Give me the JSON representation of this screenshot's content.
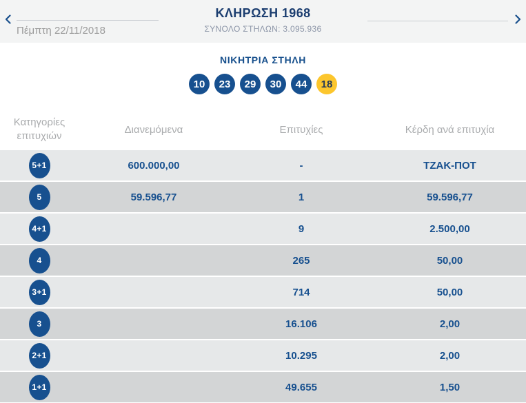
{
  "header": {
    "title": "ΚΛΗΡΩΣΗ 1968",
    "total_columns": "ΣΥΝΟΛΟ ΣΤΗΛΩΝ: 3.095.936",
    "date": "Πέμπτη 22/11/2018"
  },
  "winning": {
    "label": "ΝΙΚΗΤΡΙΑ ΣΤΗΛΗ",
    "numbers": [
      "10",
      "23",
      "29",
      "30",
      "44"
    ],
    "bonus": "18"
  },
  "table": {
    "headers": {
      "category": "Κατηγορίες επιτυχιών",
      "distributed": "Διανεμόμενα",
      "winners": "Επιτυχίες",
      "prize": "Κέρδη ανά επιτυχία"
    },
    "rows": [
      {
        "category": "5+1",
        "distributed": "600.000,00",
        "winners": "-",
        "prize": "ΤΖΑΚ-ΠΟΤ"
      },
      {
        "category": "5",
        "distributed": "59.596,77",
        "winners": "1",
        "prize": "59.596,77"
      },
      {
        "category": "4+1",
        "distributed": "",
        "winners": "9",
        "prize": "2.500,00"
      },
      {
        "category": "4",
        "distributed": "",
        "winners": "265",
        "prize": "50,00"
      },
      {
        "category": "3+1",
        "distributed": "",
        "winners": "714",
        "prize": "50,00"
      },
      {
        "category": "3",
        "distributed": "",
        "winners": "16.106",
        "prize": "2,00"
      },
      {
        "category": "2+1",
        "distributed": "",
        "winners": "10.295",
        "prize": "2,00"
      },
      {
        "category": "1+1",
        "distributed": "",
        "winners": "49.655",
        "prize": "1,50"
      }
    ]
  },
  "colors": {
    "accent_blue": "#17508f",
    "navy_text": "#1c3e70",
    "bonus_yellow": "#fcc62d",
    "row_light": "#e6e8e9",
    "row_dark": "#d3d5d6"
  }
}
